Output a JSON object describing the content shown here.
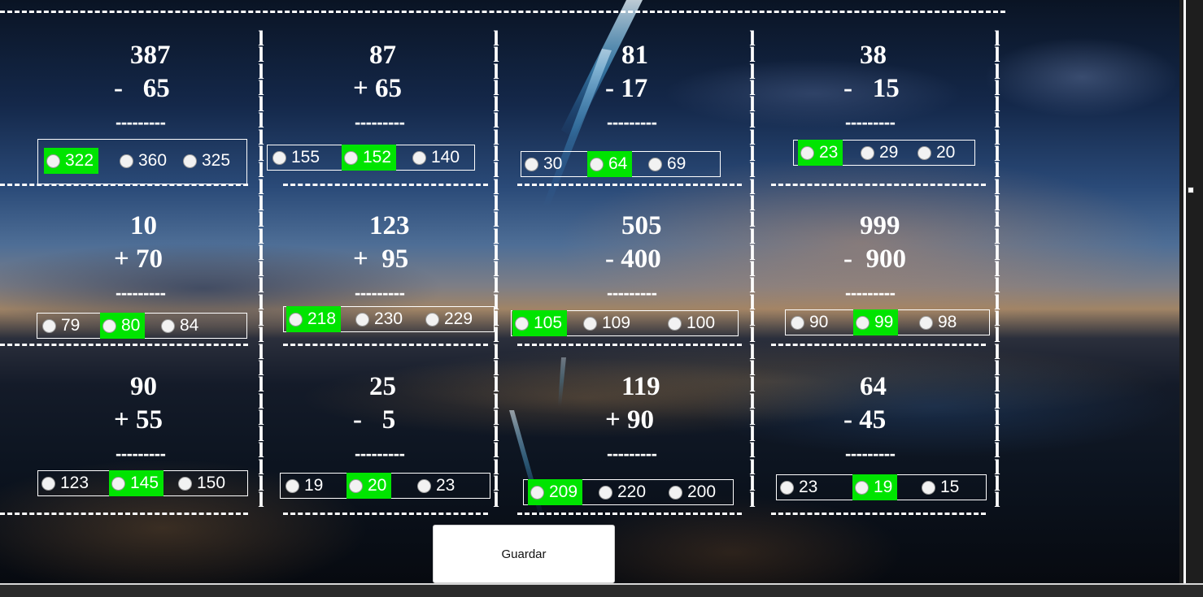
{
  "separator_glyph": "l",
  "problems": [
    {
      "top": "387",
      "bottom": "-   65",
      "dashes": "---------",
      "options": [
        {
          "label": "322",
          "selected": true
        },
        {
          "label": "360",
          "selected": false
        },
        {
          "label": "325",
          "selected": false
        }
      ]
    },
    {
      "top": "87",
      "bottom": "+ 65",
      "dashes": "---------",
      "options": [
        {
          "label": "155",
          "selected": false
        },
        {
          "label": "152",
          "selected": true
        },
        {
          "label": "140",
          "selected": false
        }
      ]
    },
    {
      "top": "81",
      "bottom": "- 17",
      "dashes": "---------",
      "options": [
        {
          "label": "30",
          "selected": false
        },
        {
          "label": "64",
          "selected": true
        },
        {
          "label": "69",
          "selected": false
        }
      ]
    },
    {
      "top": "38",
      "bottom": "-   15",
      "dashes": "---------",
      "options": [
        {
          "label": "23",
          "selected": true
        },
        {
          "label": "29",
          "selected": false
        },
        {
          "label": "20",
          "selected": false
        }
      ]
    },
    {
      "top": "10",
      "bottom": "+ 70",
      "dashes": "---------",
      "options": [
        {
          "label": "79",
          "selected": false
        },
        {
          "label": "80",
          "selected": true
        },
        {
          "label": "84",
          "selected": false
        }
      ]
    },
    {
      "top": "123",
      "bottom": "+  95",
      "dashes": "---------",
      "options": [
        {
          "label": "218",
          "selected": true
        },
        {
          "label": "230",
          "selected": false
        },
        {
          "label": "229",
          "selected": false
        }
      ]
    },
    {
      "top": "505",
      "bottom": "- 400",
      "dashes": "---------",
      "options": [
        {
          "label": "105",
          "selected": true
        },
        {
          "label": "109",
          "selected": false
        },
        {
          "label": "100",
          "selected": false
        }
      ]
    },
    {
      "top": "999",
      "bottom": "-  900",
      "dashes": "---------",
      "options": [
        {
          "label": "90",
          "selected": false
        },
        {
          "label": "99",
          "selected": true
        },
        {
          "label": "98",
          "selected": false
        }
      ]
    },
    {
      "top": "90",
      "bottom": "+ 55",
      "dashes": "---------",
      "options": [
        {
          "label": "123",
          "selected": false
        },
        {
          "label": "145",
          "selected": true
        },
        {
          "label": "150",
          "selected": false
        }
      ]
    },
    {
      "top": "25",
      "bottom": "-   5",
      "dashes": "---------",
      "options": [
        {
          "label": "19",
          "selected": false
        },
        {
          "label": "20",
          "selected": true
        },
        {
          "label": "23",
          "selected": false
        }
      ]
    },
    {
      "top": "119",
      "bottom": "+ 90",
      "dashes": "---------",
      "options": [
        {
          "label": "209",
          "selected": true
        },
        {
          "label": "220",
          "selected": false
        },
        {
          "label": "200",
          "selected": false
        }
      ]
    },
    {
      "top": "64",
      "bottom": "- 45",
      "dashes": "---------",
      "options": [
        {
          "label": "23",
          "selected": false
        },
        {
          "label": "19",
          "selected": true
        },
        {
          "label": "15",
          "selected": false
        }
      ]
    }
  ],
  "save_button": {
    "label": "Guardar"
  },
  "colors": {
    "selected": "#00e400",
    "text": "#ffffff"
  }
}
